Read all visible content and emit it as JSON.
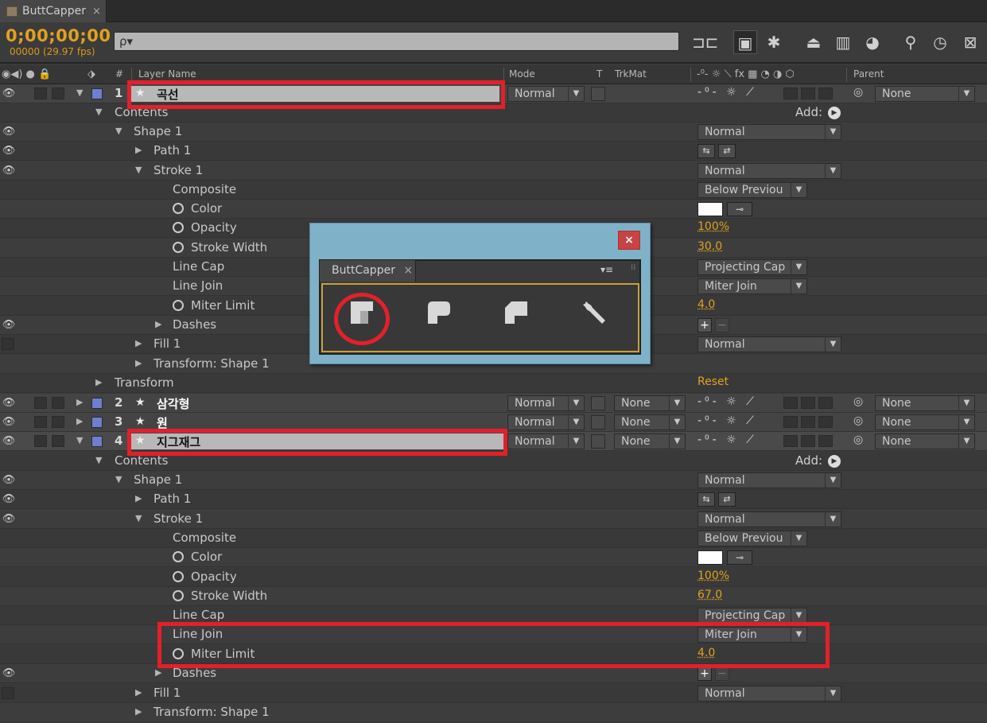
{
  "tab": {
    "title": "ButtCapper",
    "close": "×"
  },
  "toolbar": {
    "timecode": "0;00;00;00",
    "frames": "00000 (29.97 fps)",
    "search_placeholder": "ρ▾"
  },
  "columns": {
    "layer_name": "Layer Name",
    "mode": "Mode",
    "t": "T",
    "trkmat": "TrkMat",
    "parent": "Parent",
    "hash": "#"
  },
  "layers": [
    {
      "num": "1",
      "name": "곡선",
      "mode": "Normal",
      "parent": "None"
    },
    {
      "num": "2",
      "name": "삼각형",
      "mode": "Normal",
      "trkmat": "None",
      "parent": "None"
    },
    {
      "num": "3",
      "name": "원",
      "mode": "Normal",
      "trkmat": "None",
      "parent": "None"
    },
    {
      "num": "4",
      "name": "지그재그",
      "mode": "Normal",
      "trkmat": "None",
      "parent": "None"
    }
  ],
  "props1": {
    "contents": "Contents",
    "add": "Add:",
    "shape": "Shape 1",
    "shape_mode": "Normal",
    "path": "Path 1",
    "stroke": "Stroke 1",
    "stroke_mode": "Normal",
    "composite": "Composite",
    "composite_val": "Below Previou",
    "color": "Color",
    "opacity": "Opacity",
    "opacity_val": "100%",
    "stroke_width": "Stroke Width",
    "stroke_width_val": "30.0",
    "line_cap": "Line Cap",
    "line_cap_val": "Projecting Cap",
    "line_join": "Line Join",
    "line_join_val": "Miter Join",
    "miter_limit": "Miter Limit",
    "miter_limit_val": "4.0",
    "dashes": "Dashes",
    "fill": "Fill 1",
    "fill_mode": "Normal",
    "transform_shape": "Transform: Shape 1",
    "transform": "Transform",
    "reset": "Reset"
  },
  "props4": {
    "contents": "Contents",
    "add": "Add:",
    "shape": "Shape 1",
    "shape_mode": "Normal",
    "path": "Path 1",
    "stroke": "Stroke 1",
    "stroke_mode": "Normal",
    "composite": "Composite",
    "composite_val": "Below Previou",
    "color": "Color",
    "opacity": "Opacity",
    "opacity_val": "100%",
    "stroke_width": "Stroke Width",
    "stroke_width_val": "67.0",
    "line_cap": "Line Cap",
    "line_cap_val": "Projecting Cap",
    "line_join": "Line Join",
    "line_join_val": "Miter Join",
    "miter_limit": "Miter Limit",
    "miter_limit_val": "4.0",
    "dashes": "Dashes",
    "fill": "Fill 1",
    "fill_mode": "Normal",
    "transform_shape": "Transform: Shape 1"
  },
  "dialog": {
    "close": "×",
    "panel_title": "ButtCapper",
    "panel_close": "×",
    "menu": "▾≡"
  },
  "colors": {
    "accent_orange": "#e0a21e",
    "highlight_red": "#e3202a",
    "dialog_blue": "#7fb2c9",
    "label_blue": "#6e7fd0"
  }
}
